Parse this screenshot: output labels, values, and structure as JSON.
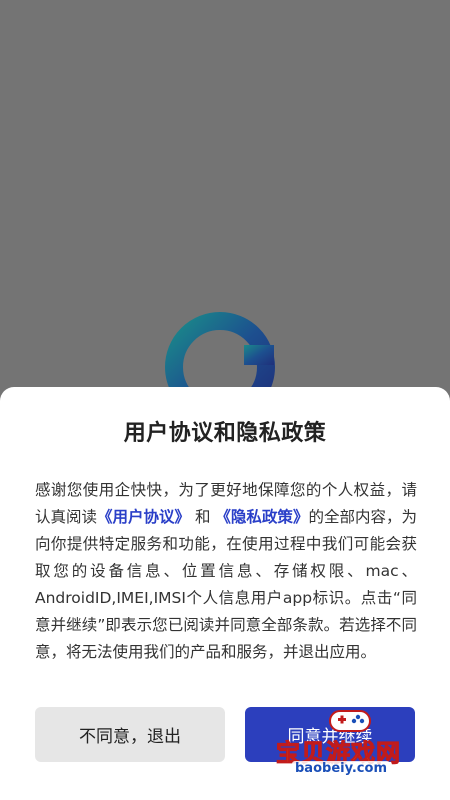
{
  "dialog": {
    "title": "用户协议和隐私政策",
    "body_before": "感谢您使用企快快，为了更好地保障您的个人权益，请认真阅读",
    "user_agreement_link": "《用户协议》",
    "connector": " 和 ",
    "privacy_policy_link": "《隐私政策》",
    "body_after": "的全部内容，为向你提供特定服务和功能，在使用过程中我们可能会获取您的设备信息、位置信息、存储权限、mac、AndroidID,IMEI,IMSI个人信息用户app标识。点击“同意并继续”即表示您已阅读并同意全部条款。若选择不同意，将无法使用我们的产品和服务，并退出应用。"
  },
  "buttons": {
    "disagree_label": "不同意，退出",
    "agree_label": "同意并继续"
  },
  "watermark": {
    "text": "宝贝游戏网",
    "url": "baobeiy.com"
  },
  "colors": {
    "overlay": "#747474",
    "link": "#2a3fc8",
    "primary": "#2c3fbd",
    "secondary": "#e6e6e6"
  }
}
